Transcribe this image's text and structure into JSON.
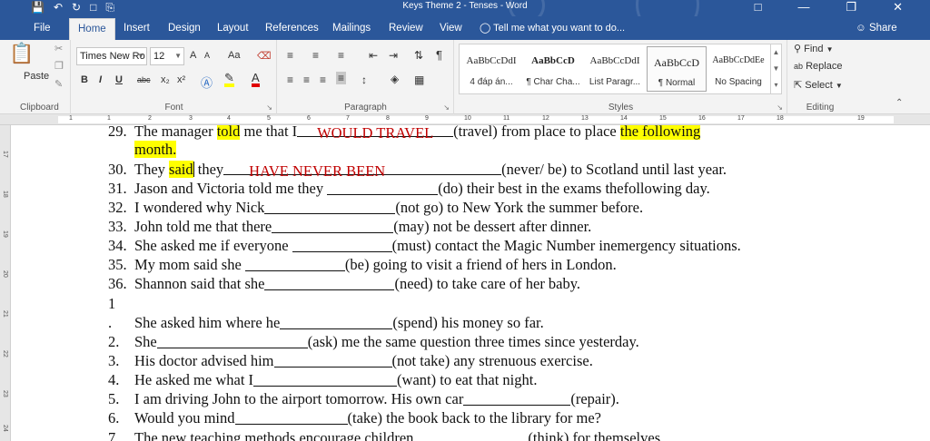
{
  "window": {
    "title": "Keys Theme 2 - Tenses - Word"
  },
  "tabs": [
    "File",
    "Home",
    "Insert",
    "Design",
    "Layout",
    "References",
    "Mailings",
    "Review",
    "View"
  ],
  "tell_me": "Tell me what you want to do...",
  "share": "Share",
  "ribbon": {
    "clipboard": {
      "paste": "Paste",
      "label": "Clipboard"
    },
    "font": {
      "name": "Times New Ro",
      "size": "12",
      "label": "Font",
      "grow": "A",
      "shrink": "A",
      "case": "Aa",
      "bold": "B",
      "italic": "I",
      "underline": "U",
      "strike": "abc",
      "sub": "x₂",
      "sup": "x²"
    },
    "paragraph": {
      "label": "Paragraph"
    },
    "styles": {
      "label": "Styles",
      "items": [
        {
          "preview": "AaBbCcDdI",
          "name": "4 đáp án..."
        },
        {
          "preview": "AaBbCcD",
          "name": "¶ Char Cha..."
        },
        {
          "preview": "AaBbCcDdI",
          "name": "List Paragr..."
        },
        {
          "preview": "AaBbCcD",
          "name": "¶ Normal"
        },
        {
          "preview": "AaBbCcDdEe",
          "name": "No Spacing"
        }
      ]
    },
    "editing": {
      "find": "Find",
      "replace": "Replace",
      "select": "Select",
      "label": "Editing"
    }
  },
  "ruler_ticks": [
    "1",
    "1",
    "2",
    "3",
    "4",
    "5",
    "6",
    "7",
    "8",
    "9",
    "10",
    "11",
    "12",
    "13",
    "14",
    "15",
    "16",
    "17",
    "18",
    "19"
  ],
  "vruler_ticks": [
    "17",
    "18",
    "19",
    "20",
    "21",
    "22",
    "23",
    "24"
  ],
  "doc": {
    "l29": {
      "num": "29.",
      "a": "The manager ",
      "hl1": "told",
      "b": " me that I",
      "ans": "WOULD TRAVEL",
      "c": "(travel) from place to place ",
      "hl2": "the following",
      "d": "month."
    },
    "l30": {
      "num": "30.",
      "a": "They ",
      "hl": "said",
      "b": " they",
      "ans": "HAVE NEVER BEEN",
      "c": "(never/ be) to Scotland until last year."
    },
    "items": [
      {
        "num": "31.",
        "pre": "Jason and Victoria told me they ",
        "post": "(do) their best in the exams thefollowing day."
      },
      {
        "num": "32.",
        "pre": "I wondered why Nick",
        "post": "(not go) to New York the summer before."
      },
      {
        "num": "33.",
        "pre": "John told me that there",
        "post": "(may) not be dessert after dinner."
      },
      {
        "num": "34.",
        "pre": "She asked me if everyone ",
        "post": "(must) contact the Magic Number inemergency situations."
      },
      {
        "num": "35.",
        "pre": "My mom said she ",
        "post": "(be) going to visit a friend of hers in London."
      },
      {
        "num": "36.",
        "pre": "Shannon said that she",
        "post": "(need) to take care of her baby."
      }
    ],
    "section": "1",
    "items2": [
      {
        "num": ".",
        "pre": "She asked him where he",
        "post": "(spend) his money so far."
      },
      {
        "num": "2.",
        "pre": "She",
        "post": "(ask) me the same question three times since yesterday."
      },
      {
        "num": "3.",
        "pre": "His doctor advised him",
        "post": "(not take) any strenuous exercise."
      },
      {
        "num": "4.",
        "pre": "He asked me what I",
        "post": "(want) to eat that night."
      },
      {
        "num": "5.",
        "pre": "I am driving John to the airport tomorrow. His own car",
        "post": "(repair)."
      },
      {
        "num": "6.",
        "pre": "Would you mind",
        "post": "(take) the book back to the library for me?"
      },
      {
        "num": "7.",
        "pre": "The new teaching methods encourage children",
        "post": "(think) for themselves."
      }
    ]
  }
}
